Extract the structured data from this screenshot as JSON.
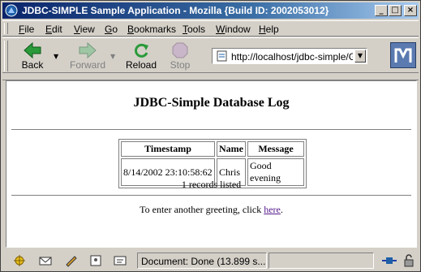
{
  "window": {
    "title": "JDBC-SIMPLE Sample Application - Mozilla {Build ID: 2002053012}",
    "minimize": "_",
    "maximize": "□",
    "close": "×"
  },
  "menu": [
    "File",
    "Edit",
    "View",
    "Go",
    "Bookmarks",
    "Tools",
    "Window",
    "Help"
  ],
  "toolbar": {
    "back": "Back",
    "forward": "Forward",
    "reload": "Reload",
    "stop": "Stop",
    "url": "http://localhost/jdbc-simple/Gre"
  },
  "page": {
    "title": "JDBC-Simple Database Log",
    "table": {
      "headers": [
        "Timestamp",
        "Name",
        "Message"
      ],
      "rows": [
        [
          "8/14/2002 23:10:58:62",
          "Chris",
          "Good evening"
        ]
      ]
    },
    "records_text": "1 records listed",
    "footer_prefix": "To enter another greeting, click ",
    "footer_link": "here",
    "footer_suffix": "."
  },
  "status": {
    "text": "Document: Done (13.899 s..."
  }
}
